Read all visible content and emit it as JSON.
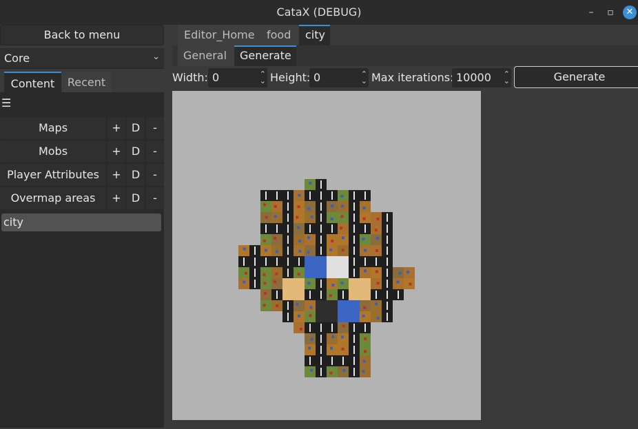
{
  "window": {
    "title": "CataX (DEBUG)"
  },
  "left": {
    "back_button": "Back to menu",
    "core_select": "Core",
    "tabs": [
      "Content",
      "Recent"
    ],
    "menu_icon": "☰",
    "rows": [
      {
        "label": "Maps",
        "plus": "+",
        "d": "D",
        "minus": "-"
      },
      {
        "label": "Mobs",
        "plus": "+",
        "d": "D",
        "minus": "-"
      },
      {
        "label": "Player Attributes",
        "plus": "+",
        "d": "D",
        "minus": "-"
      },
      {
        "label": "Overmap areas",
        "plus": "+",
        "d": "D",
        "minus": "-"
      }
    ],
    "selected_item": "city"
  },
  "editor": {
    "tabs": [
      "Editor_Home",
      "food",
      "city"
    ],
    "subtabs": [
      "General",
      "Generate"
    ],
    "width_label": "Width:",
    "width_value": "0",
    "height_label": "Height:",
    "height_value": "0",
    "maxit_label": "Max iterations:",
    "maxit_value": "10000",
    "generate_button": "Generate"
  }
}
